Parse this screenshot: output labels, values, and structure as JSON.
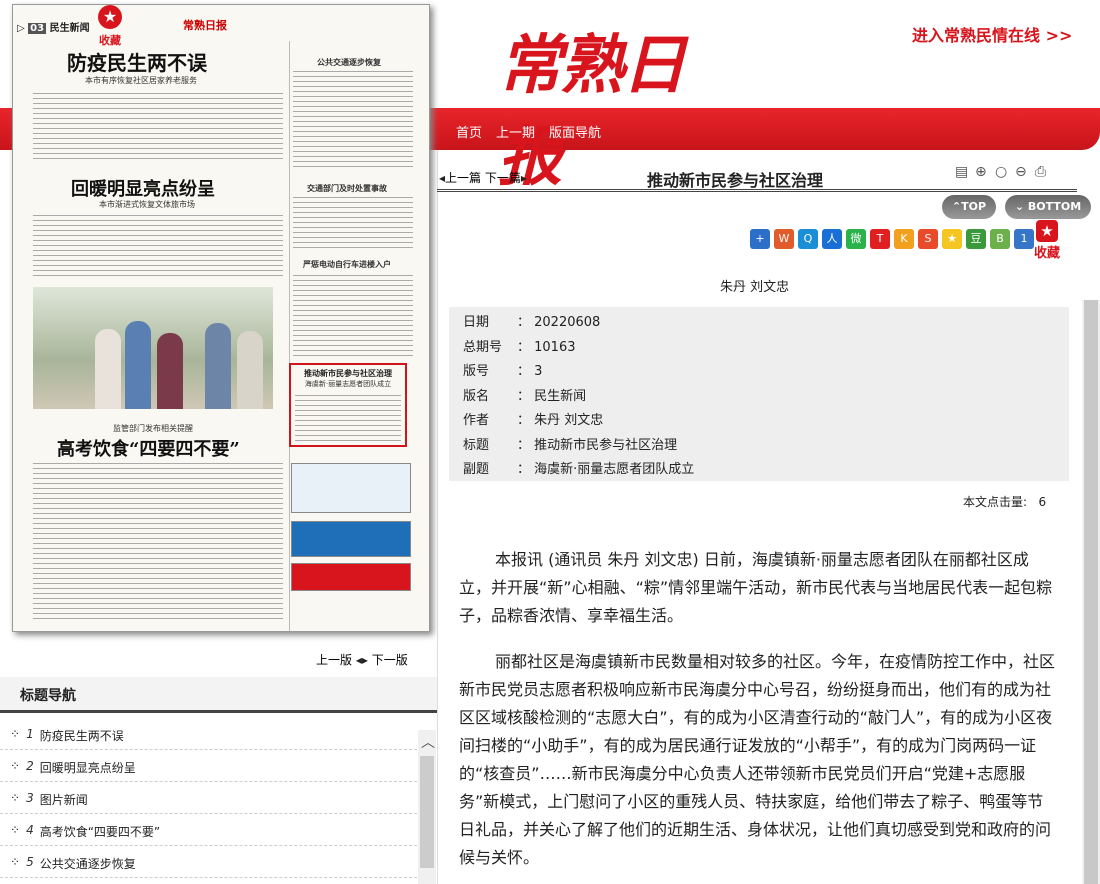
{
  "header": {
    "logo": "常熟日报",
    "online_link": "进入常熟民情在线 >>",
    "nav": [
      "首页",
      "上一期",
      "版面导航"
    ]
  },
  "paper": {
    "page_label": "03",
    "section": "民生新闻",
    "masthead": "常熟日报",
    "fav": "收藏",
    "headlines": [
      "防疫民生两不误",
      "回暖明显亮点纷呈",
      "高考饮食“四要四不要”"
    ],
    "subheads": [
      "本市有序恢复社区居家养老服务",
      "本市渐进式恢复文体旅市场",
      "监管部门发布相关提醒"
    ],
    "side_heads": [
      "公共交通逐步恢复",
      "交通部门及时处置事故",
      "严惩电动自行车进楼入户",
      "推动新市民参与社区治理"
    ],
    "hl_sub": "海虞新·丽量志愿者团队成立"
  },
  "pager": {
    "prev": "上一版",
    "next": "下一版"
  },
  "title_nav": {
    "heading": "标题导航",
    "items": [
      {
        "n": "1",
        "t": "防疫民生两不误"
      },
      {
        "n": "2",
        "t": "回暖明显亮点纷呈"
      },
      {
        "n": "3",
        "t": "图片新闻"
      },
      {
        "n": "4",
        "t": "高考饮食“四要四不要”"
      },
      {
        "n": "5",
        "t": "公共交通逐步恢复"
      }
    ]
  },
  "article": {
    "prev": "上一篇",
    "next": "下一篇",
    "title": "推动新市民参与社区治理",
    "top": "TOP",
    "bottom": "BOTTOM",
    "fav": "收藏",
    "author": "朱丹 刘文忠",
    "meta": [
      {
        "k": "日期",
        "v": "20220608"
      },
      {
        "k": "总期号",
        "v": "10163"
      },
      {
        "k": "版号",
        "v": "3"
      },
      {
        "k": "版名",
        "v": "民生新闻"
      },
      {
        "k": "作者",
        "v": "朱丹  刘文忠"
      },
      {
        "k": "标题",
        "v": "推动新市民参与社区治理"
      },
      {
        "k": "副题",
        "v": "海虞新·丽量志愿者团队成立"
      }
    ],
    "hits_label": "本文点击量:",
    "hits": "6",
    "paras": [
      "本报讯  (通讯员 朱丹 刘文忠) 日前，海虞镇新·丽量志愿者团队在丽都社区成立，并开展“新”心相融、“粽”情邻里端午活动，新市民代表与当地居民代表一起包粽子，品粽香浓情、享幸福生活。",
      "丽都社区是海虞镇新市民数量相对较多的社区。今年，在疫情防控工作中，社区新市民党员志愿者积极响应新市民海虞分中心号召，纷纷挺身而出，他们有的成为社区区域核酸检测的“志愿大白”，有的成为小区清查行动的“敲门人”，有的成为小区夜间扫楼的“小助手”，有的成为居民通行证发放的“小帮手”，有的成为门岗两码一证的“核查员”……新市民海虞分中心负责人还带领新市民党员们开启“党建+志愿服务”新模式，上门慰问了小区的重残人员、特扶家庭，给他们带去了粽子、鸭蛋等节日礼品，并关心了解了他们的近期生活、身体状况，让他们真切感受到党和政府的问候与关怀。"
    ]
  }
}
